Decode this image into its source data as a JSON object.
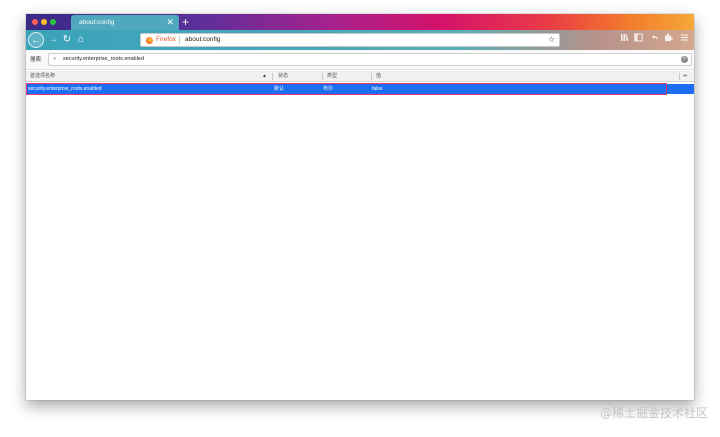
{
  "tab": {
    "title": "about:config",
    "close_glyph": "✕",
    "new_tab_glyph": "+"
  },
  "navbar": {
    "back_glyph": "←",
    "forward_glyph": "→",
    "reload_glyph": "↻",
    "home_glyph": "⌂",
    "identity_label": "Firefox",
    "url": "about:config",
    "bookmark_glyph": "☆",
    "toolbar_icons": [
      "library-icon",
      "sidebar-icon",
      "undo-icon",
      "extension-icon",
      "menu-icon"
    ]
  },
  "search": {
    "label": "搜索:",
    "value": "security.enterprise_roots.enabled",
    "mag_glyph": "⌕",
    "clear_glyph": "×"
  },
  "table": {
    "headers": {
      "name": "首选项名称",
      "status": "状态",
      "type": "类型",
      "value": "值"
    },
    "sort_glyph": "▲",
    "column_picker_glyph": "⇹",
    "rows": [
      {
        "name": "security.enterprise_roots.enabled",
        "status": "默认",
        "type": "布尔",
        "value": "false",
        "selected": true
      }
    ]
  },
  "watermark": "@稀土掘金技术社区",
  "colors": {
    "selection": "#1b6ef3",
    "highlight_border": "#e5356a",
    "navbar_accent": "#3aa3b9"
  }
}
